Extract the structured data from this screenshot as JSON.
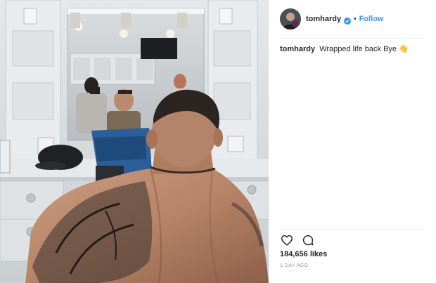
{
  "post": {
    "photo_alt": "tattooed man's back facing a dressing room mirror",
    "header": {
      "username": "tomhardy",
      "separator": "•",
      "follow_label": "Follow",
      "verified_icon": "verified-badge-icon"
    },
    "caption": {
      "username": "tomhardy",
      "text": "Wrapped life back Bye 👋"
    },
    "actions": {
      "like_icon": "heart-icon",
      "comment_icon": "comment-icon"
    },
    "likes_label": "184,656 likes",
    "timestamp": "1 day ago"
  },
  "colors": {
    "accent": "#3897f0",
    "text": "#262626",
    "muted": "#999999",
    "divider": "#efefef"
  }
}
